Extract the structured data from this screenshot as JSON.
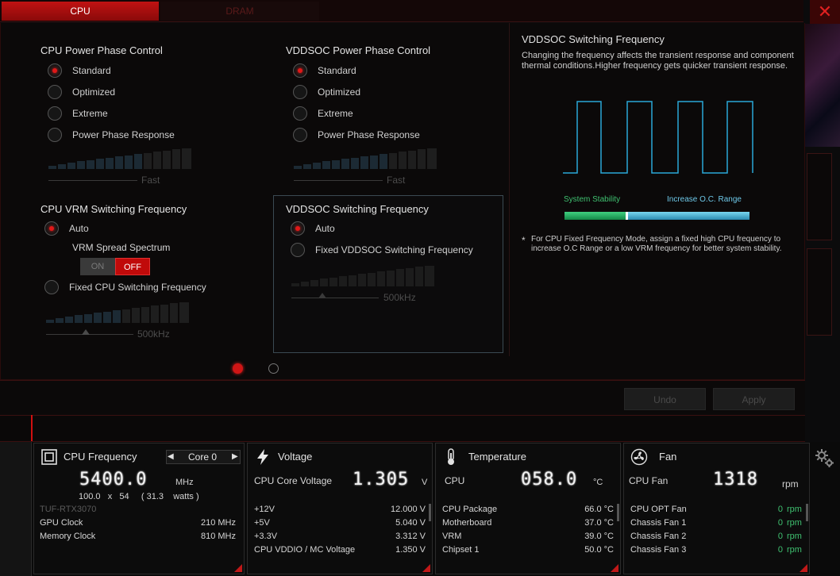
{
  "tabs": [
    {
      "label": "CPU",
      "active": true
    },
    {
      "label": "DRAM",
      "active": false
    }
  ],
  "close_label": "✕",
  "cpu_power_phase": {
    "title": "CPU Power Phase Control",
    "options": [
      "Standard",
      "Optimized",
      "Extreme",
      "Power Phase Response"
    ],
    "selected": 0,
    "ramp_label": "Fast"
  },
  "vddsoc_power_phase": {
    "title": "VDDSOC Power Phase Control",
    "options": [
      "Standard",
      "Optimized",
      "Extreme",
      "Power Phase Response"
    ],
    "selected": 0,
    "ramp_label": "Fast"
  },
  "cpu_vrm": {
    "title": "CPU VRM Switching Frequency",
    "auto_label": "Auto",
    "spread_label": "VRM Spread Spectrum",
    "toggle_on": "ON",
    "toggle_off": "OFF",
    "fixed_label": "Fixed CPU Switching Frequency",
    "ramp_label": "500kHz"
  },
  "vddsoc_switching": {
    "title": "VDDSOC Switching Frequency",
    "auto_label": "Auto",
    "fixed_label": "Fixed VDDSOC Switching Frequency",
    "ramp_label": "500kHz"
  },
  "info": {
    "title": "VDDSOC Switching Frequency",
    "description": "Changing the frequency affects the transient response and component thermal conditions.Higher frequency gets quicker transient response.",
    "stability_label": "System Stability",
    "oc_label": "Increase O.C. Range",
    "note_star": "*",
    "note": "For CPU Fixed Frequency Mode, assign a fixed high CPU frequency to increase O.C Range or a low VRM frequency for better system stability.",
    "wave_color": "#2aa8d8",
    "stability_color": "#22b060",
    "oc_color": "#4ab8d8"
  },
  "pager": {
    "pages": 2,
    "current": 1
  },
  "actions": {
    "undo": "Undo",
    "apply": "Apply"
  },
  "monitor": {
    "cpu_freq": {
      "title": "CPU Frequency",
      "core": "Core 0",
      "value": "5400.0",
      "unit": "MHz",
      "detail": "100.0   x   54     ( 31.3    watts )",
      "gpu_name": "TUF-RTX3070",
      "rows": [
        {
          "label": "GPU Clock",
          "value": "210 MHz"
        },
        {
          "label": "Memory Clock",
          "value": "810 MHz"
        }
      ]
    },
    "voltage": {
      "title": "Voltage",
      "main_label": "CPU Core Voltage",
      "value": "1.305",
      "unit": "V",
      "rows": [
        {
          "label": "+12V",
          "value": "12.000  V"
        },
        {
          "label": "+5V",
          "value": "5.040  V"
        },
        {
          "label": "+3.3V",
          "value": "3.312  V"
        },
        {
          "label": "CPU VDDIO / MC Voltage",
          "value": "1.350  V"
        }
      ]
    },
    "temperature": {
      "title": "Temperature",
      "main_label": "CPU",
      "value": "058.0",
      "unit": "°C",
      "rows": [
        {
          "label": "CPU Package",
          "value": "66.0 °C"
        },
        {
          "label": "Motherboard",
          "value": "37.0 °C"
        },
        {
          "label": "VRM",
          "value": "39.0 °C"
        },
        {
          "label": "Chipset 1",
          "value": "50.0 °C"
        }
      ]
    },
    "fan": {
      "title": "Fan",
      "main_label": "CPU Fan",
      "value": "1318",
      "unit": "rpm",
      "rows": [
        {
          "label": "CPU OPT Fan",
          "value": "0",
          "unit": "rpm"
        },
        {
          "label": "Chassis Fan 1",
          "value": "0",
          "unit": "rpm"
        },
        {
          "label": "Chassis Fan 2",
          "value": "0",
          "unit": "rpm"
        },
        {
          "label": "Chassis Fan 3",
          "value": "0",
          "unit": "rpm"
        }
      ]
    }
  },
  "icons": {
    "cpu": "cpu-chip-icon",
    "voltage": "lightning-icon",
    "temperature": "thermometer-icon",
    "fan": "fan-icon",
    "settings": "gear-icon"
  }
}
